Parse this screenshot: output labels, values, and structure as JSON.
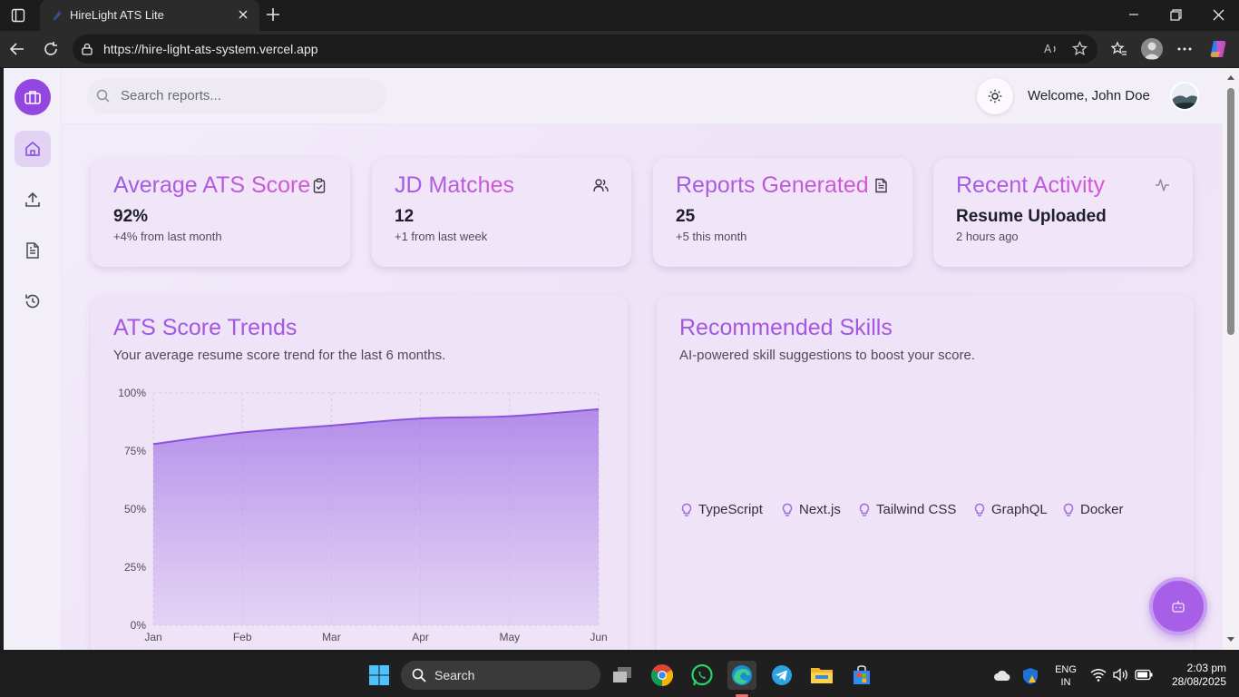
{
  "browser": {
    "tab_title": "HireLight ATS Lite",
    "url": "https://hire-light-ats-system.vercel.app"
  },
  "header": {
    "search_placeholder": "Search reports...",
    "welcome": "Welcome, John Doe"
  },
  "stats": [
    {
      "title": "Average ATS Score",
      "value": "92%",
      "sub": "+4% from last month",
      "icon": "clipboard-check-icon"
    },
    {
      "title": "JD Matches",
      "value": "12",
      "sub": "+1 from last week",
      "icon": "users-icon"
    },
    {
      "title": "Reports Generated",
      "value": "25",
      "sub": "+5 this month",
      "icon": "file-text-icon"
    },
    {
      "title": "Recent Activity",
      "value": "Resume Uploaded",
      "sub": "2 hours ago",
      "icon": "activity-icon"
    }
  ],
  "trends": {
    "title": "ATS Score Trends",
    "description": "Your average resume score trend for the last 6 months."
  },
  "chart_data": {
    "type": "area",
    "categories": [
      "Jan",
      "Feb",
      "Mar",
      "Apr",
      "May",
      "Jun"
    ],
    "values": [
      78,
      83,
      86,
      89,
      90,
      93
    ],
    "yticks": [
      "0%",
      "25%",
      "50%",
      "75%",
      "100%"
    ],
    "ylim": [
      0,
      100
    ],
    "grid": true
  },
  "skills_panel": {
    "title": "Recommended Skills",
    "description": "AI-powered skill suggestions to boost your score.",
    "skills": [
      "TypeScript",
      "Next.js",
      "Tailwind CSS",
      "GraphQL",
      "Docker"
    ]
  },
  "taskbar": {
    "search": "Search",
    "lang1": "ENG",
    "lang2": "IN",
    "time": "2:03 pm",
    "date": "28/08/2025"
  },
  "colors": {
    "accent": "#8b4ce6",
    "accent_pink": "#d656d8",
    "page_bg": "#f0e6f8"
  }
}
